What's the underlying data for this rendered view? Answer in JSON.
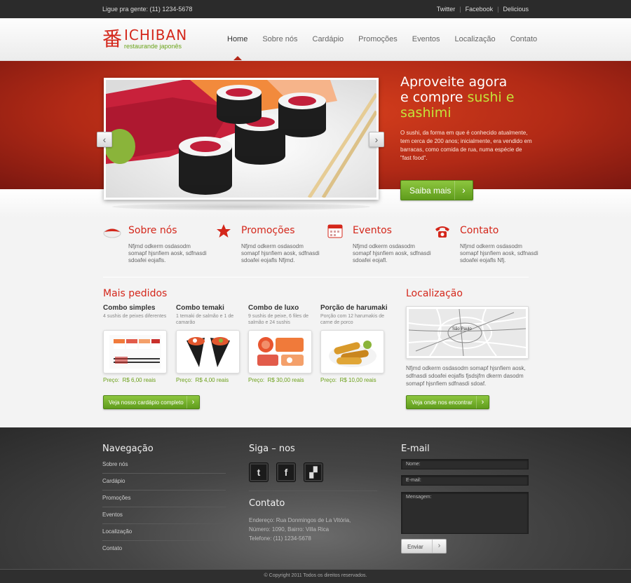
{
  "topbar": {
    "phone": "Ligue pra gente: (11) 1234-5678",
    "social": [
      "Twitter",
      "Facebook",
      "Delicious"
    ],
    "separator": "|"
  },
  "brand": {
    "name": "ICHIBAN",
    "tagline": "restaurande japonês",
    "mark": "番",
    "color": "#d4271b"
  },
  "nav": {
    "items": [
      "Home",
      "Sobre nós",
      "Cardápio",
      "Promoções",
      "Eventos",
      "Localização",
      "Contato"
    ],
    "active": "Home"
  },
  "hero": {
    "title_line1": "Aproveite agora",
    "title_line2_a": "e compre ",
    "title_line2_b": "sushi e",
    "title_line3": "sashimi",
    "text": "O sushi, da forma em que é conhecido atualmente, tem cerca de 200 anos; inicialmente, era vendido em barracas, como comida de rua, numa espécie de \"fast food\".",
    "button": "Saiba mais",
    "arrow_prev": "‹",
    "arrow_next": "›"
  },
  "features": [
    {
      "title": "Sobre nós",
      "text": "Nfjmd odkerm osdasodm somapf hjsnfiem aosk, sdfnasdi sdoafei eojafls.",
      "icon": "sushi-icon"
    },
    {
      "title": "Promoções",
      "text": "Nfjmd odkerm osdasodm somapf hjsnfiem aosk, sdfnasdi sdoafei eojafls Nfjmd.",
      "icon": "star-icon"
    },
    {
      "title": "Eventos",
      "text": "Nfjmd odkerm osdasodm somapf hjsnfiem aosk, sdfnasdi sdoafei eojafl.",
      "icon": "calendar-icon"
    },
    {
      "title": "Contato",
      "text": "Nfjmd odkerm osdasodm somapf hjsnfiem aosk, sdfnasdi sdoafei eojafls Nfj.",
      "icon": "phone-icon"
    }
  ],
  "mais_pedidos": {
    "title": "Mais pedidos",
    "products": [
      {
        "name": "Combo simples",
        "desc": "4 sushis de peixes diferentes",
        "price_label": "Preço:",
        "price": "R$ 6,00 reais"
      },
      {
        "name": "Combo temaki",
        "desc": "1 temaki de salmão e 1 de camarão",
        "price_label": "Preço:",
        "price": "R$ 4,00 reais"
      },
      {
        "name": "Combo de luxo",
        "desc": "9 sushis de peixe, 6 files de salmão e 24 sushis",
        "price_label": "Preço:",
        "price": "R$ 30,00 reais"
      },
      {
        "name": "Porção de harumaki",
        "desc": "Porção com 12 harumakis de carne de porco",
        "price_label": "Preço:",
        "price": "R$ 10,00 reais"
      }
    ],
    "button": "Veja nosso cardápio completo"
  },
  "localizacao": {
    "title": "Localização",
    "map_label": "São Paulo",
    "text": "Nfjmd odkerm osdasodm somapf hjsnfiem aosk, sdfnasdi sdoafei eojafls fjsdsjfm dkerm dasodm somapf hjsnfiem sdfnasdi sdoaf.",
    "button": "Veja onde nos encontrar"
  },
  "footer": {
    "nav_title": "Navegação",
    "nav_items": [
      "Sobre nós",
      "Cardápio",
      "Promoções",
      "Eventos",
      "Localização",
      "Contato"
    ],
    "siga_title": "Siga – nos",
    "social_glyphs": [
      "t",
      "f",
      "▞"
    ],
    "contato_title": "Contato",
    "endereco": "Endereço: Rua Donmingos de La Vitória,",
    "numero": "Número: 1090,  Bairro: Villa Rica",
    "telefone": "Telefone: (11) 1234-5678",
    "email_title": "E-mail",
    "field_nome": "Nome:",
    "field_email": "E-mail:",
    "field_mensagem": "Mensagem:",
    "send": "Enviar",
    "copyright": "© Copyright 2011  Todos os direitos reservados."
  },
  "chevron": "›"
}
